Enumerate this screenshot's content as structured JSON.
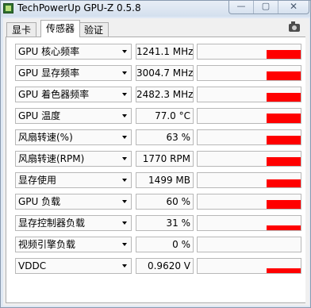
{
  "window": {
    "title": "TechPowerUp GPU-Z 0.5.8",
    "controls": {
      "minimize": "—",
      "maximize": "▢",
      "close": "✕"
    }
  },
  "tabs": [
    {
      "label": "显卡",
      "active": false
    },
    {
      "label": "传感器",
      "active": true
    },
    {
      "label": "验证",
      "active": false
    }
  ],
  "sensors": [
    {
      "label": "GPU 核心频率",
      "value": "1241.1 MHz",
      "level": 0.6
    },
    {
      "label": "GPU 显存频率",
      "value": "3004.7 MHz",
      "level": 0.6
    },
    {
      "label": "GPU 着色器频率",
      "value": "2482.3 MHz",
      "level": 0.6
    },
    {
      "label": "GPU 温度",
      "value": "77.0 °C",
      "level": 0.65
    },
    {
      "label": "风扇转速(%)",
      "value": "63 %",
      "level": 0.63
    },
    {
      "label": "风扇转速(RPM)",
      "value": "1770 RPM",
      "level": 0.6
    },
    {
      "label": "显存使用",
      "value": "1499 MB",
      "level": 0.55
    },
    {
      "label": "GPU 负载",
      "value": "60 %",
      "level": 0.6
    },
    {
      "label": "显存控制器负载",
      "value": "31 %",
      "level": 0.31
    },
    {
      "label": "视频引擎负载",
      "value": "0 %",
      "level": 0
    },
    {
      "label": "VDDC",
      "value": "0.9620 V",
      "level": 0.35
    }
  ],
  "colors": {
    "graph_bar": "#ff0000"
  },
  "icons": {
    "camera": "camera-icon",
    "dropdown": "chevron-down-icon"
  }
}
